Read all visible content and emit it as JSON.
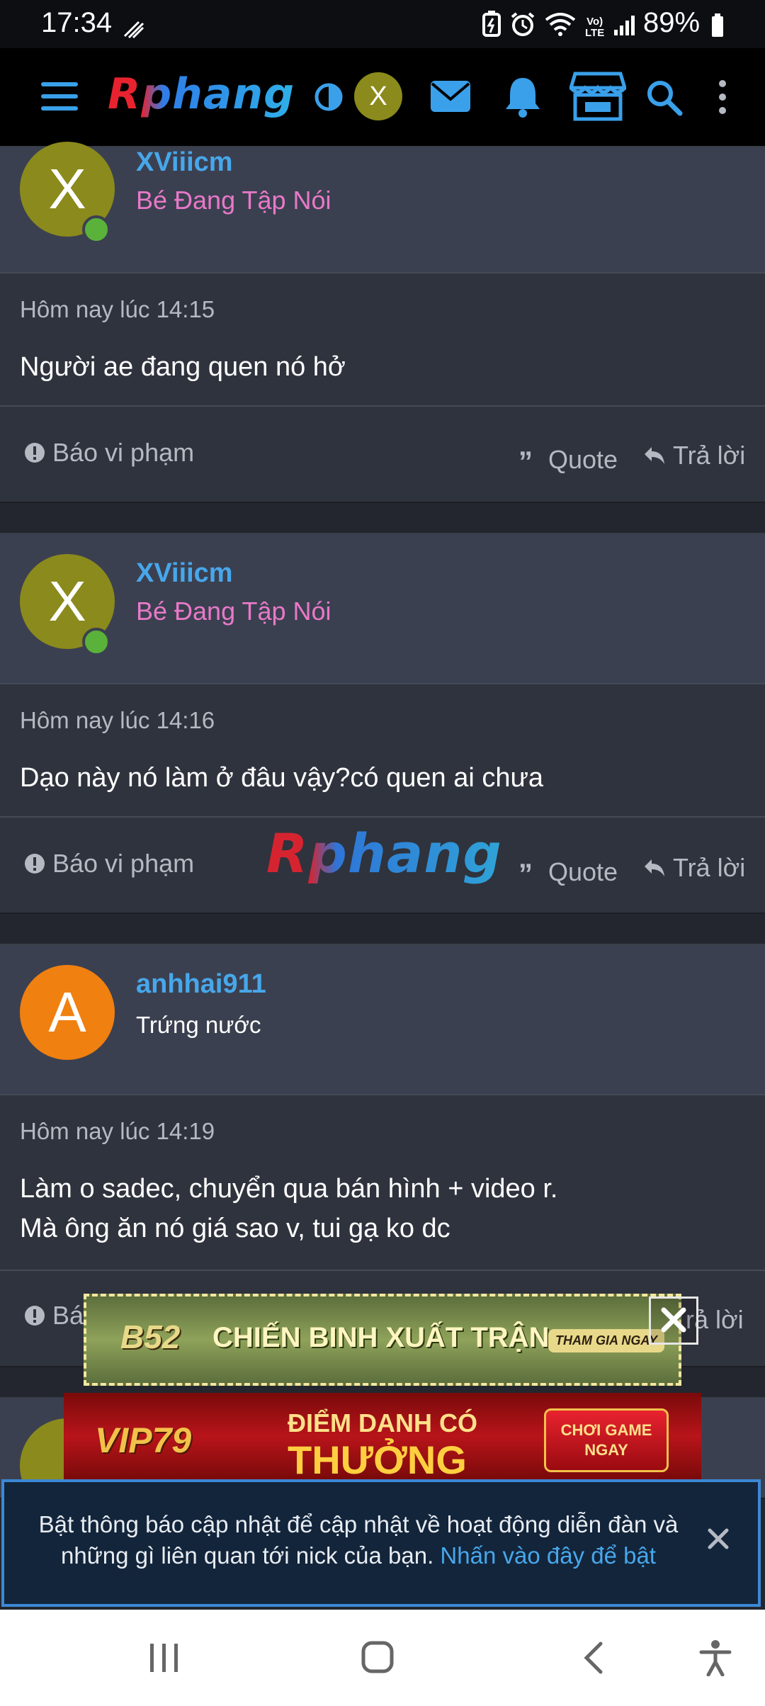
{
  "status_bar": {
    "time": "17:34",
    "battery": "89%"
  },
  "header": {
    "logo": "Rphang",
    "avatar_letter": "X"
  },
  "posts": [
    {
      "avatar_letter": "X",
      "username": "XViiicm",
      "user_title": "Bé Đang Tập Nói",
      "timestamp": "Hôm nay lúc 14:15",
      "body": [
        "Người ae đang quen nó hở"
      ]
    },
    {
      "avatar_letter": "X",
      "username": "XViiicm",
      "user_title": "Bé Đang Tập Nói",
      "timestamp": "Hôm nay lúc 14:16",
      "body": [
        "Dạo này nó làm ở đâu vậy?có quen ai chưa"
      ]
    },
    {
      "avatar_letter": "A",
      "username": "anhhai911",
      "user_title": "Trứng nước",
      "timestamp": "Hôm nay lúc 14:19",
      "body": [
        "Làm o sadec, chuyển qua bán hình + video r.",
        "Mà ông ăn nó giá sao v, tui gạ ko dc"
      ]
    }
  ],
  "actions": {
    "report": "Báo vi phạm",
    "report_partial": "Bá",
    "quote": "Quote",
    "reply": "Trả lời",
    "reply_partial": "rả lời"
  },
  "watermark": "Rphang",
  "ads": {
    "banner1": {
      "brand": "B52",
      "headline": "CHIẾN BINH XUẤT TRẬN",
      "cta": "THAM GIA NGAY"
    },
    "banner2": {
      "brand": "VIP79",
      "headline_line1": "ĐIỂM DANH CÓ",
      "headline_line2": "THƯỞNG",
      "cta_line1": "CHƠI GAME",
      "cta_line2": "NGAY"
    }
  },
  "notification": {
    "text": "Bật thông báo cập nhật để cập nhật về hoạt động diễn đàn và những gì liên quan tới nick của bạn.",
    "link": "Nhấn vào đây để bật"
  },
  "colors": {
    "accent": "#47a7eb",
    "title_pink": "#e879c8",
    "avatar_olive": "#8b8a1c",
    "avatar_orange": "#f08010"
  }
}
